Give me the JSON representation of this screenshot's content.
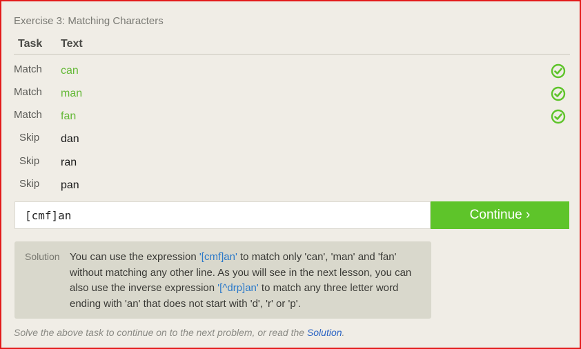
{
  "exercise_title": "Exercise 3: Matching Characters",
  "table": {
    "headers": {
      "task": "Task",
      "text": "Text"
    },
    "rows": [
      {
        "task": "Match",
        "text": "can",
        "status": "matched"
      },
      {
        "task": "Match",
        "text": "man",
        "status": "matched"
      },
      {
        "task": "Match",
        "text": "fan",
        "status": "matched"
      },
      {
        "task": "Skip",
        "text": "dan",
        "status": ""
      },
      {
        "task": "Skip",
        "text": "ran",
        "status": ""
      },
      {
        "task": "Skip",
        "text": "pan",
        "status": ""
      }
    ]
  },
  "input": {
    "value": "[cmf]an"
  },
  "continue_label": "Continue ›",
  "solution": {
    "label": "Solution",
    "text_1": "You can use the expression ",
    "code_1": "'[cmf]an'",
    "text_2": " to match only 'can', 'man' and 'fan' without matching any other line. As you will see in the next lesson, you can also use the inverse expression ",
    "code_2": "'[^drp]an'",
    "text_3": " to match any three letter word ending with 'an' that does not start with 'd', 'r' or 'p'."
  },
  "footer": {
    "text": "Solve the above task to continue on to the next problem, or read the ",
    "link": "Solution",
    "end": "."
  },
  "colors": {
    "green": "#5ec42a",
    "match_text": "#63b836",
    "link": "#2b64c4",
    "code": "#2b79c9",
    "frame": "#e31b1b"
  },
  "icons": {
    "check": "check-circle-icon"
  }
}
